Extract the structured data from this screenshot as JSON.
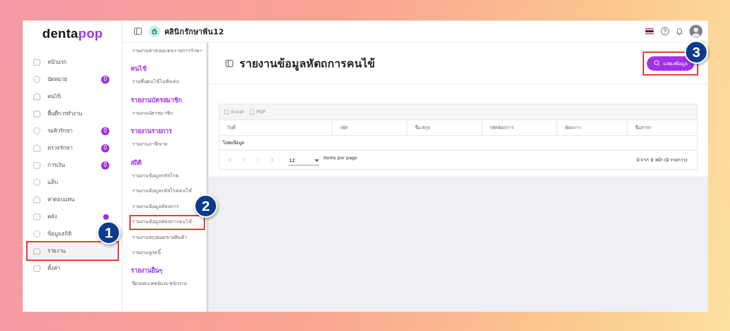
{
  "logo": {
    "dark": "denta",
    "accent": "pop"
  },
  "sidebar": {
    "items": [
      {
        "label": "หน้าแรก",
        "selected": false
      },
      {
        "label": "นัดหมาย",
        "selected": false,
        "badge": "0"
      },
      {
        "label": "คนไข้",
        "selected": false
      },
      {
        "label": "พื้นที่การทำงาน",
        "selected": false
      },
      {
        "label": "รอคิวรักษา",
        "selected": false,
        "badge": "0"
      },
      {
        "label": "ตรวจรักษา",
        "selected": false,
        "badge": "0"
      },
      {
        "label": "การเงิน",
        "selected": false,
        "badge": "0"
      },
      {
        "label": "แล็บ",
        "selected": false
      },
      {
        "label": "ค่าตอบแทน",
        "selected": false
      },
      {
        "label": "คลัง",
        "selected": false,
        "dot": true
      },
      {
        "label": "ข้อมูลสถิติ",
        "selected": false
      },
      {
        "label": "รายงาน",
        "selected": true,
        "callout": "1"
      },
      {
        "label": "ตั้งค่า",
        "selected": false
      }
    ]
  },
  "submenu": {
    "items": [
      {
        "kind": "link",
        "label": "รายงานค่าตอบแทนรายการรักษา"
      },
      {
        "kind": "heading",
        "label": "คนไข้"
      },
      {
        "kind": "link",
        "label": "รายชื่อคนไข้ไม่ติดต่อ"
      },
      {
        "kind": "heading",
        "label": "รายงานบัตรสมาชิก"
      },
      {
        "kind": "link",
        "label": "รายงานบัตรสมาชิก"
      },
      {
        "kind": "heading",
        "label": "รายงานรายการ"
      },
      {
        "kind": "link",
        "label": "รายงานภาษีขาย"
      },
      {
        "kind": "heading",
        "label": "สถิติ"
      },
      {
        "kind": "link",
        "label": "รายงานข้อมูลรหัสโรค"
      },
      {
        "kind": "link",
        "label": "รายงานข้อมูลรหัสโรคคนไข้"
      },
      {
        "kind": "link",
        "label": "รายงานข้อมูลหัตถการ"
      },
      {
        "kind": "link",
        "label": "รายงานข้อมูลหัตถการคนไข้",
        "callout": "2"
      },
      {
        "kind": "link",
        "label": "รายงานสรุปยอดขายสินค้า"
      },
      {
        "kind": "link",
        "label": "รายงานลูกหนี้"
      },
      {
        "kind": "heading",
        "label": "รายงานอื่นๆ"
      },
      {
        "kind": "link",
        "label": "ปิดยอดแพทย์และพนักงาน"
      }
    ]
  },
  "topbar": {
    "clinic_name": "คลินิกรักษาฟัน12"
  },
  "page": {
    "title": "รายงานข้อมูลหัตถการคนไข้",
    "show_button": {
      "label": "แสดงข้อมูล",
      "callout": "3"
    }
  },
  "table": {
    "exports": [
      {
        "label": "Excel",
        "disabled": true
      },
      {
        "label": "PDF",
        "disabled": true
      }
    ],
    "columns": [
      "วันที่",
      "รหัส",
      "ชื่อ-สกุล",
      "รหัสหัตถการ",
      "หัตถการ",
      "ชื่อสาขา"
    ],
    "empty_text": "ไม่พบข้อมูล",
    "pagination": {
      "page_size": "12",
      "items_per_page": "Items per page",
      "summary": "0 จาก 0 หน้า (0 รายการ)"
    }
  }
}
